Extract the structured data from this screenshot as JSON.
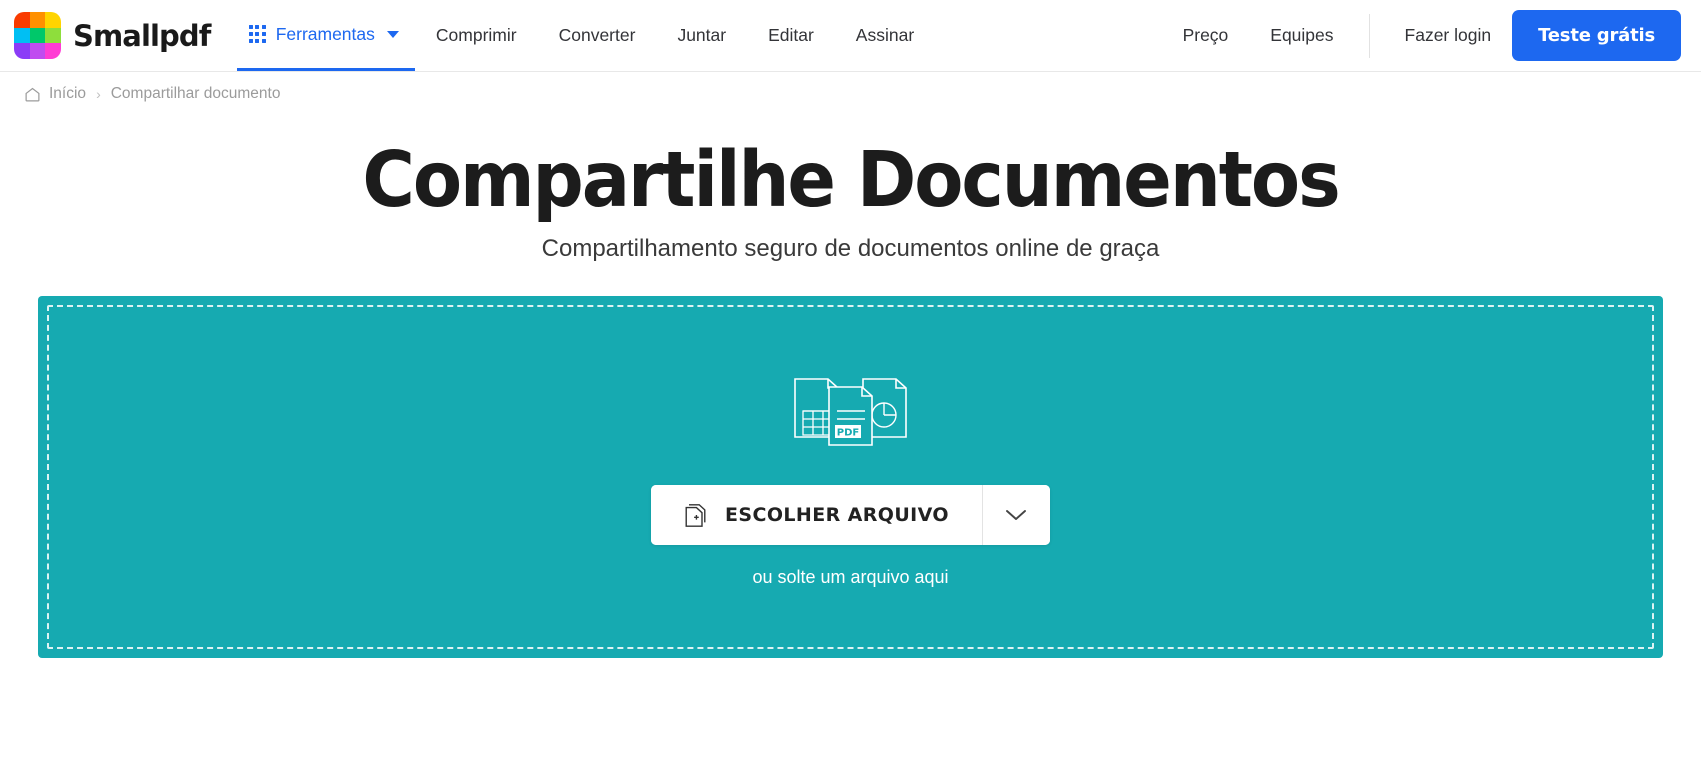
{
  "header": {
    "brand": {
      "name": "Smallpdf",
      "logo_icon": "smallpdf-logo-icon",
      "logo_colors": [
        "#f93b00",
        "#ff9000",
        "#ffd400",
        "#00bff3",
        "#00c86a",
        "#8ede3c",
        "#8b3cf7",
        "#c04cf0",
        "#ff3cd4"
      ]
    },
    "tools": {
      "label": "Ferramentas",
      "grid_icon": "grid-dots-icon",
      "caret_icon": "chevron-down-icon",
      "accent_color": "#1d68f0"
    },
    "nav_items": [
      {
        "label": "Comprimir"
      },
      {
        "label": "Converter"
      },
      {
        "label": "Juntar"
      },
      {
        "label": "Editar"
      },
      {
        "label": "Assinar"
      }
    ],
    "right_items": [
      {
        "label": "Preço"
      },
      {
        "label": "Equipes"
      }
    ],
    "login_label": "Fazer login",
    "cta_label": "Teste grátis",
    "cta_color": "#1d68f0"
  },
  "breadcrumb": {
    "home_icon": "home-icon",
    "home_label": "Início",
    "separator": "›",
    "current_label": "Compartilhar documento"
  },
  "hero": {
    "title": "Compartilhe Documentos",
    "subtitle": "Compartilhamento seguro de documentos online de graça"
  },
  "dropzone": {
    "background_color": "#16aab1",
    "illustration_icon": "documents-stack-icon",
    "pdf_badge_label": "PDF",
    "choose_file_label": "ESCOLHER ARQUIVO",
    "choose_file_icon": "file-plus-icon",
    "dropdown_icon": "chevron-down-icon",
    "drop_hint": "ou solte um arquivo aqui"
  }
}
